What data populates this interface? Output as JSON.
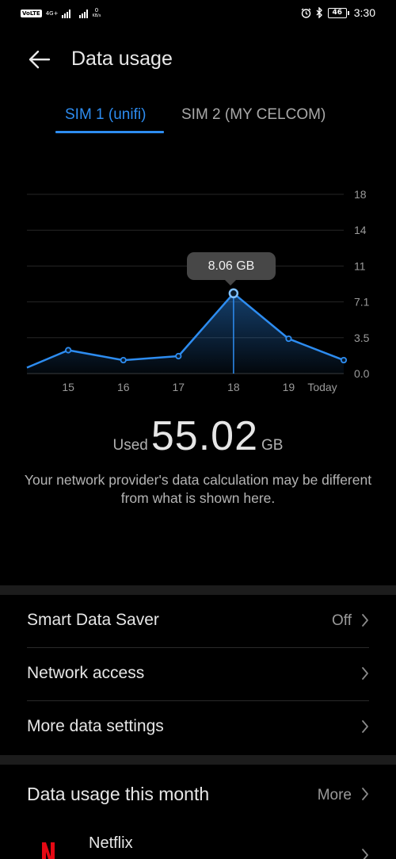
{
  "status_bar": {
    "volte": "VoLTE",
    "network_type": "4G+",
    "speed_value": "0",
    "speed_unit": "KB/s",
    "battery": "46",
    "time": "3:30"
  },
  "header": {
    "title": "Data usage",
    "back_icon": "arrow-left-icon"
  },
  "tabs": [
    {
      "label": "SIM 1 (unifi)",
      "selected": true
    },
    {
      "label": "SIM 2 (MY CELCOM)",
      "selected": false
    }
  ],
  "colors": {
    "accent": "#2d8cf0",
    "background": "#000000",
    "divider": "#1c1c1c"
  },
  "chart_data": {
    "type": "area",
    "x_tick_labels": [
      "15",
      "16",
      "17",
      "18",
      "19",
      "Today"
    ],
    "x": [
      14.25,
      15,
      16,
      17,
      18,
      19,
      20
    ],
    "values": [
      0.6,
      2.35,
      1.35,
      1.75,
      8.06,
      3.5,
      1.35
    ],
    "point_markers": [
      false,
      true,
      true,
      true,
      true,
      true,
      true
    ],
    "y_tick_labels": [
      "18",
      "14",
      "11",
      "7.1",
      "3.5",
      "0.0"
    ],
    "y_ticks": [
      18,
      14.4,
      10.8,
      7.2,
      3.6,
      0
    ],
    "ylim": [
      0,
      18
    ],
    "grid": true,
    "highlight": {
      "index": 4,
      "label": "8.06 GB"
    }
  },
  "usage": {
    "used_label": "Used",
    "used_value": "55.02",
    "used_unit": "GB",
    "disclaimer": "Your network provider's data calculation may be different from what is shown here."
  },
  "settings": [
    {
      "label": "Smart Data Saver",
      "value": "Off"
    },
    {
      "label": "Network access",
      "value": ""
    },
    {
      "label": "More data settings",
      "value": ""
    }
  ],
  "monthly": {
    "title": "Data usage this month",
    "more_label": "More",
    "apps": [
      {
        "name": "Netflix",
        "icon": "netflix-icon"
      }
    ]
  }
}
